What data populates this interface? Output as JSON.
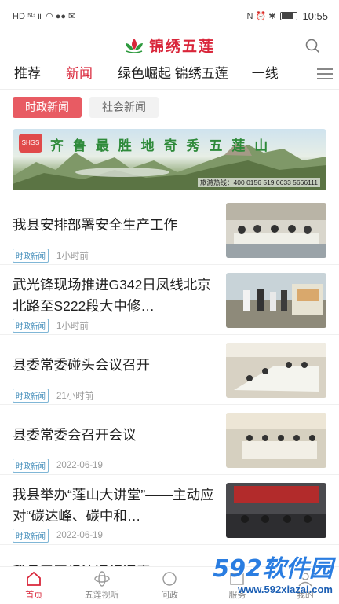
{
  "status_bar": {
    "left_icons": "HD ⁵ᴳ ⅲ ◠ ●● ✉",
    "right_icons": "N ⏰ ✱",
    "time": "10:55"
  },
  "header": {
    "logo_text": "锦绣五莲"
  },
  "category_tabs": [
    {
      "label": "推荐"
    },
    {
      "label": "新闻"
    },
    {
      "label": "绿色崛起 锦绣五莲"
    },
    {
      "label": "一线"
    }
  ],
  "sub_tabs": [
    {
      "label": "时政新闻"
    },
    {
      "label": "社会新闻"
    }
  ],
  "banner": {
    "logo_text": "SHGS",
    "slogan": "齐 鲁 最 胜 地   奇 秀 五 莲 山",
    "hotline": "旅游热线：400 0156 519    0633 5666111"
  },
  "news": [
    {
      "title": "我县安排部署安全生产工作",
      "tag": "时政新闻",
      "time": "1小时前"
    },
    {
      "title": "武光锋现场推进G342日凤线北京北路至S222段大中修…",
      "tag": "时政新闻",
      "time": "1小时前"
    },
    {
      "title": "县委常委碰头会议召开",
      "tag": "时政新闻",
      "time": "21小时前"
    },
    {
      "title": "县委常委会召开会议",
      "tag": "时政新闻",
      "time": "2022-06-19"
    },
    {
      "title": "我县举办“莲山大讲堂”——主动应对“碳达峰、碳中和…",
      "tag": "时政新闻",
      "time": "2022-06-19"
    }
  ],
  "peek_title": "我县召开经济运行调度…",
  "bottom_nav": [
    {
      "label": "首页"
    },
    {
      "label": "五莲视听"
    },
    {
      "label": "问政"
    },
    {
      "label": "服务"
    },
    {
      "label": "我的"
    }
  ],
  "watermark": {
    "brand": "592软件园",
    "url": "www.592xiazai.com"
  },
  "colors": {
    "accent": "#d9263a",
    "tag_blue": "#3d8ab8"
  }
}
